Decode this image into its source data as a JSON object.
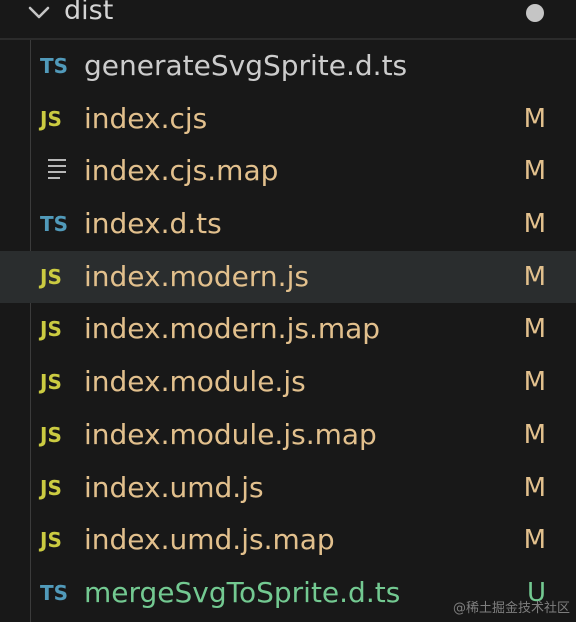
{
  "folder": {
    "name": "dist"
  },
  "colors": {
    "modified": "#e2c08d",
    "untracked": "#73c991",
    "ts_icon": "#519aba",
    "js_icon": "#cbcb41"
  },
  "files": [
    {
      "name": "generateSvgSprite.d.ts",
      "icon": "TS",
      "icon_type": "typescript-icon",
      "status": "",
      "state": "normal"
    },
    {
      "name": "index.cjs",
      "icon": "JS",
      "icon_type": "javascript-icon",
      "status": "M",
      "state": "modified"
    },
    {
      "name": "index.cjs.map",
      "icon": "",
      "icon_type": "map-file-icon",
      "status": "M",
      "state": "modified"
    },
    {
      "name": "index.d.ts",
      "icon": "TS",
      "icon_type": "typescript-icon",
      "status": "M",
      "state": "modified"
    },
    {
      "name": "index.modern.js",
      "icon": "JS",
      "icon_type": "javascript-icon",
      "status": "M",
      "state": "modified"
    },
    {
      "name": "index.modern.js.map",
      "icon": "JS",
      "icon_type": "javascript-icon",
      "status": "M",
      "state": "modified"
    },
    {
      "name": "index.module.js",
      "icon": "JS",
      "icon_type": "javascript-icon",
      "status": "M",
      "state": "modified"
    },
    {
      "name": "index.module.js.map",
      "icon": "JS",
      "icon_type": "javascript-icon",
      "status": "M",
      "state": "modified"
    },
    {
      "name": "index.umd.js",
      "icon": "JS",
      "icon_type": "javascript-icon",
      "status": "M",
      "state": "modified"
    },
    {
      "name": "index.umd.js.map",
      "icon": "JS",
      "icon_type": "javascript-icon",
      "status": "M",
      "state": "modified"
    },
    {
      "name": "mergeSvgToSprite.d.ts",
      "icon": "TS",
      "icon_type": "typescript-icon",
      "status": "U",
      "state": "untracked"
    }
  ],
  "watermark": "@稀土掘金技术社区"
}
